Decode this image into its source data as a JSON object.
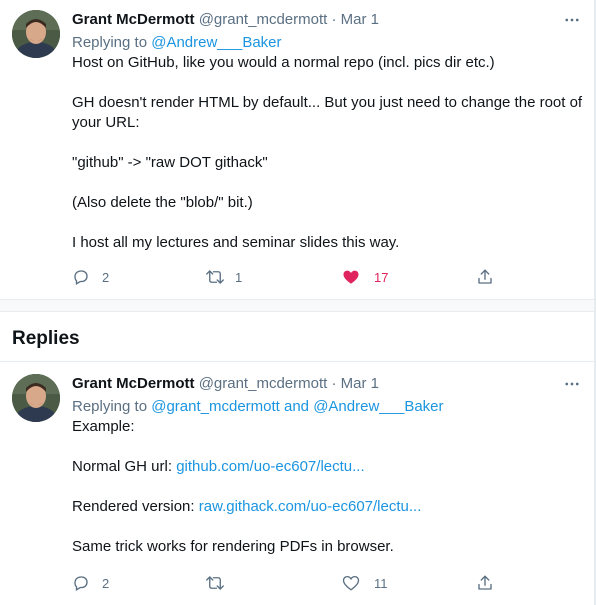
{
  "tweet": {
    "name": "Grant McDermott",
    "handle": "@grant_mcdermott",
    "separator": "·",
    "date": "Mar 1",
    "replying_prefix": "Replying to ",
    "replying_mention": "@Andrew___Baker",
    "paragraphs": [
      "Host on GitHub, like you would a normal repo (incl. pics dir etc.)",
      "GH doesn't render HTML by default... But you just need to change the root of your URL:",
      "\"github\" -> \"raw DOT githack\"",
      "(Also delete the \"blob/\" bit.)",
      "I host all my lectures and seminar slides this way."
    ],
    "actions": {
      "replies": "2",
      "retweets": "1",
      "likes": "17",
      "liked": true
    }
  },
  "replies_section": {
    "title": "Replies"
  },
  "reply": {
    "name": "Grant McDermott",
    "handle": "@grant_mcdermott",
    "separator": "·",
    "date": "Mar 1",
    "replying_prefix": "Replying to ",
    "replying_mention_1": "@grant_mcdermott",
    "replying_and": " and ",
    "replying_mention_2": "@Andrew___Baker",
    "line1": "Example:",
    "line2_prefix": "Normal GH url: ",
    "line2_link": "github.com/uo-ec607/lectu...",
    "line3_prefix": "Rendered version: ",
    "line3_link": "raw.githack.com/uo-ec607/lectu...",
    "line4": "Same trick works for rendering PDFs in browser.",
    "actions": {
      "replies": "2",
      "retweets": "",
      "likes": "11",
      "liked": false
    }
  },
  "icons": {
    "more": "more-horizontal-icon",
    "reply": "reply-bubble-icon",
    "retweet": "retweet-icon",
    "like": "heart-icon",
    "share": "share-icon"
  },
  "colors": {
    "text": "#0f1419",
    "secondary": "#5b7083",
    "link": "#1b95e0",
    "like": "#e0245e",
    "border": "#e6ecf0",
    "divider_bg": "#f7f9fa"
  }
}
